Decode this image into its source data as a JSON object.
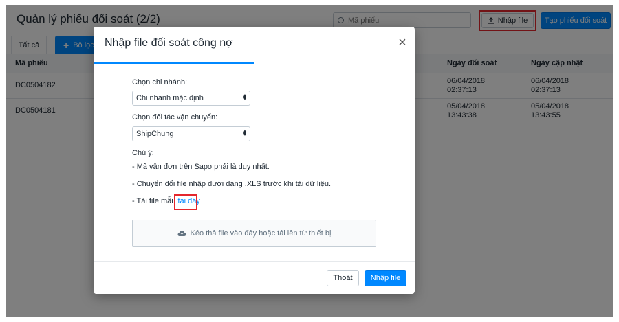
{
  "page": {
    "title": "Quản lý phiếu đối soát (2/2)",
    "search_placeholder": "Mã phiếu",
    "import_button": "Nhập file",
    "create_button": "Tạo phiếu đối soát",
    "tab_all": "Tất cả",
    "filter_button": "Bộ lọc"
  },
  "table": {
    "columns": [
      "Mã phiếu",
      "",
      "Ngày đối soát",
      "Ngày cập nhật"
    ],
    "rows": [
      {
        "code": "DC0504182",
        "reconcile_date": "06/04/2018",
        "reconcile_time": "02:37:13",
        "updated_date": "06/04/2018",
        "updated_time": "02:37:13"
      },
      {
        "code": "DC0504181",
        "reconcile_date": "05/04/2018",
        "reconcile_time": "13:43:38",
        "updated_date": "05/04/2018",
        "updated_time": "13:43:55"
      }
    ]
  },
  "modal": {
    "title": "Nhập file đối soát công nợ",
    "progress_percent": 50,
    "branch_label": "Chọn chi nhánh:",
    "branch_value": "Chi nhánh mặc định",
    "carrier_label": "Chọn đối tác vận chuyển:",
    "carrier_value": "ShipChung",
    "note_title": "Chú ý:",
    "note_1": "- Mã vận đơn trên Sapo phải là duy nhất.",
    "note_2": "- Chuyển đổi file nhập dưới dạng .XLS trước khi tải dữ liệu.",
    "note_3_prefix": "- Tải file mẫu ",
    "note_3_link": "tại đây",
    "dropzone_text": "Kéo thả file vào đây hoặc tải lên từ thiết bị",
    "cancel_button": "Thoát",
    "submit_button": "Nhập file"
  },
  "icons": {
    "close": "close-icon",
    "upload": "upload-icon",
    "cloud": "cloud-upload-icon",
    "search": "search-icon",
    "plus": "plus-icon"
  },
  "colors": {
    "primary": "#0088ff",
    "highlight": "#e5262c",
    "overlay": "rgba(0,0,0,0.5)"
  }
}
